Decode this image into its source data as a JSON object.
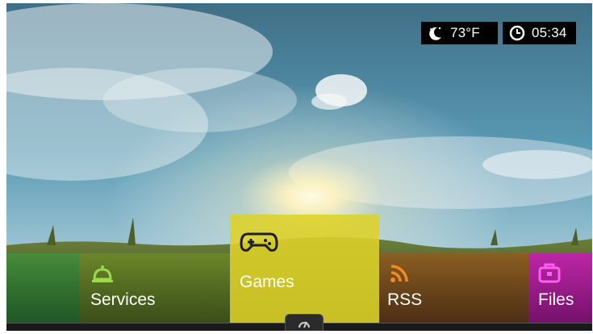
{
  "status": {
    "weather": {
      "icon": "moon-weather-icon",
      "temperature": "73°F"
    },
    "clock": {
      "icon": "clock-icon",
      "time": "05:34"
    }
  },
  "menu": {
    "items": [
      {
        "id": "left",
        "label": "",
        "color": "#3c963c"
      },
      {
        "id": "services",
        "label": "Services",
        "icon": "bell-icon",
        "color": "#9bd94a"
      },
      {
        "id": "games",
        "label": "Games",
        "icon": "gamepad-icon",
        "color": "#ded228",
        "selected": true
      },
      {
        "id": "rss",
        "label": "RSS",
        "icon": "rss-icon",
        "color": "#f28a1e"
      },
      {
        "id": "files",
        "label": "Files",
        "icon": "briefcase-icon",
        "color": "#e020c8"
      }
    ],
    "handle_icon": "speedometer-icon"
  }
}
